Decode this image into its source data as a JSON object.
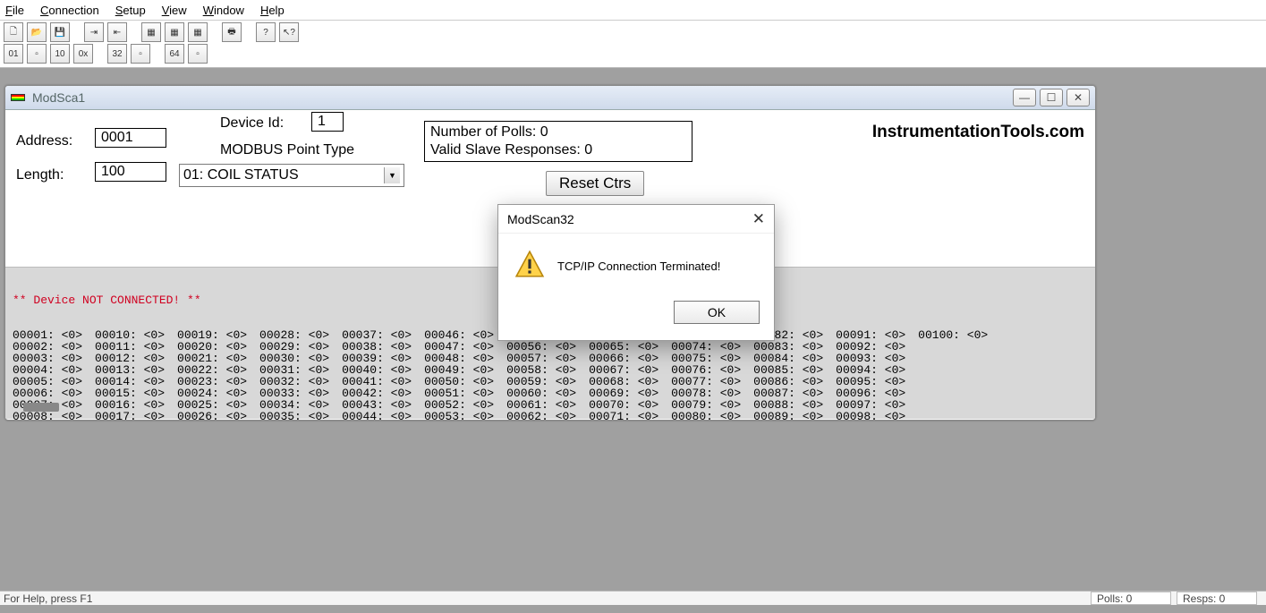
{
  "menu": {
    "file": "File",
    "connection": "Connection",
    "setup": "Setup",
    "view": "View",
    "window": "Window",
    "help": "Help"
  },
  "child": {
    "title": "ModSca1"
  },
  "form": {
    "address_label": "Address:",
    "address_value": "0001",
    "length_label": "Length:",
    "length_value": "100",
    "device_id_label": "Device Id:",
    "device_id_value": "1",
    "modbus_label": "MODBUS Point Type",
    "modbus_value": "01: COIL STATUS",
    "polls_label": "Number of Polls: 0",
    "resps_label": "Valid Slave Responses: 0",
    "reset_label": "Reset Ctrs",
    "brand": "InstrumentationTools.com"
  },
  "grid": {
    "error": "** Device NOT CONNECTED! **",
    "total_registers": 100,
    "value_token": "<0>"
  },
  "dialog": {
    "title": "ModScan32",
    "message": "TCP/IP Connection Terminated!",
    "ok": "OK"
  },
  "status": {
    "help": "For Help, press F1",
    "polls": "Polls: 0",
    "resps": "Resps: 0"
  }
}
